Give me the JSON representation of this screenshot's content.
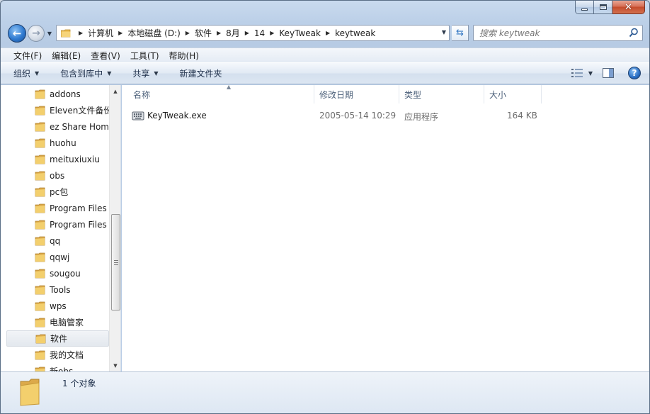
{
  "window": {
    "close_glyph": "✕"
  },
  "nav": {
    "back_glyph": "←",
    "forward_glyph": "→",
    "breadcrumb": [
      "计算机",
      "本地磁盘 (D:)",
      "软件",
      "8月",
      "14",
      "KeyTweak",
      "keytweak"
    ],
    "search_placeholder": "搜索 keytweak"
  },
  "menu": [
    "文件(F)",
    "编辑(E)",
    "查看(V)",
    "工具(T)",
    "帮助(H)"
  ],
  "commands": {
    "organize": "组织",
    "include_library": "包含到库中",
    "share": "共享",
    "new_folder": "新建文件夹",
    "help_glyph": "?"
  },
  "tree": {
    "items": [
      "addons",
      "Eleven文件备份",
      "ez Share Home",
      "huohu",
      "meituxiuxiu",
      "obs",
      "pc包",
      "Program Files",
      "Program Files",
      "qq",
      "qqwj",
      "sougou",
      "Tools",
      "wps",
      "电脑管家",
      "软件",
      "我的文档",
      "新obs"
    ],
    "selected_index": 15
  },
  "columns": {
    "name": "名称",
    "modified": "修改日期",
    "type": "类型",
    "size": "大小"
  },
  "files": [
    {
      "name": "KeyTweak.exe",
      "modified": "2005-05-14 10:29",
      "type": "应用程序",
      "size": "164 KB",
      "icon": "exe-keyboard-icon"
    }
  ],
  "status": {
    "item_count": "1 个对象"
  },
  "colors": {
    "folder": "#e8b84a",
    "accent": "#2f7ad0",
    "selected_bg": "#e6ebf1"
  }
}
